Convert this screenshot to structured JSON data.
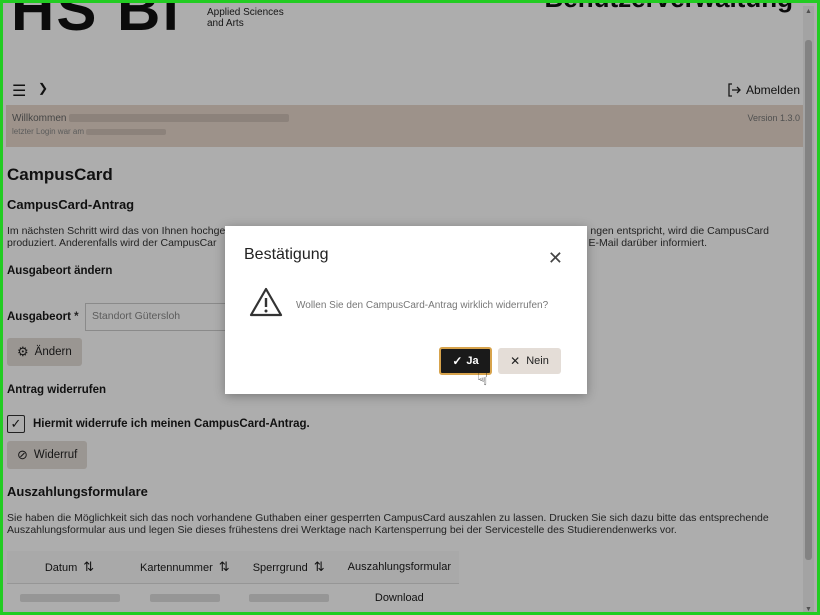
{
  "header": {
    "logo_text": "HS Bi",
    "logo_sub_line1": "Applied Sciences",
    "logo_sub_line2": "and Arts",
    "app_title": "Benutzerverwaltung",
    "logout_label": "Abmelden"
  },
  "welcome": {
    "greeting": "Willkommen",
    "last_login": "letzter Login war am",
    "version": "Version 1.3.0"
  },
  "page": {
    "title": "CampusCard",
    "section_antrag": "CampusCard-Antrag",
    "antrag_text": "Im nächsten Schritt wird das von Ihnen hochge... ...ngen entspricht, wird die CampusCard produziert. Anderenfalls wird der CampusCar... ...E-Mail darüber informiert.",
    "antrag_text_line1": "Im nächsten Schritt wird das von Ihnen hochge",
    "antrag_text_line1_end": "ngen entspricht, wird die CampusCard",
    "antrag_text_line2": "produziert. Anderenfalls wird der CampusCar",
    "antrag_text_line2_end": "E-Mail darüber informiert.",
    "section_ausgabeort": "Ausgabeort ändern",
    "ausgabeort_label": "Ausgabeort",
    "ausgabeort_required": "*",
    "ausgabeort_value": "Standort Gütersloh",
    "aendern_label": "Ändern",
    "section_widerruf": "Antrag widerrufen",
    "widerruf_checkbox_label": "Hiermit widerrufe ich meinen CampusCard-Antrag.",
    "widerruf_checked": true,
    "widerruf_button": "Widerruf",
    "section_auszahlung": "Auszahlungsformulare",
    "auszahlung_text": "Sie haben die Möglichkeit sich das noch vorhandene Guthaben einer gesperrten CampusCard auszahlen zu lassen. Drucken Sie sich dazu bitte das entsprechende Auszahlungsformular aus und legen Sie dieses frühestens drei Werktage nach Kartensperrung bei der Servicestelle des Studierendenwerks vor.",
    "table_headers": [
      "Datum",
      "Kartennummer",
      "Sperrgrund",
      "Auszahlungsformular"
    ],
    "table_rows": [
      {
        "formular": "Download"
      }
    ]
  },
  "dialog": {
    "title": "Bestätigung",
    "message": "Wollen Sie den CampusCard-Antrag wirklich widerrufen?",
    "yes_label": "Ja",
    "no_label": "Nein"
  },
  "colors": {
    "welcome_band": "#e7d8cc",
    "button_grey": "#e4ddd7",
    "primary_button": "#1a1a1a",
    "focus_ring": "#d7a34c",
    "window_border": "#22cc22"
  }
}
